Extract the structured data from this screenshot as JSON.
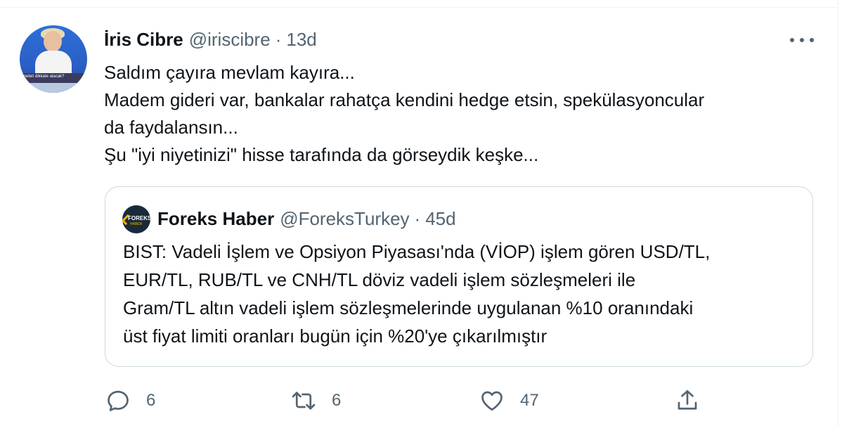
{
  "tweet": {
    "author_name": "İris Cibre",
    "handle": "@iriscibre",
    "separator": "·",
    "time": "13d",
    "text_lines": [
      "Saldım çayıra mevlam kayıra...",
      "Madem gideri var, bankalar rahatça kendini hedge etsin, spekülasyoncular",
      "da faydalansın...",
      "Şu \"iyi niyetinizi\" hisse tarafında da görseydik keşke..."
    ],
    "avatar_caption": "meleri dikkate alacak?"
  },
  "quoted": {
    "author_name": "Foreks Haber",
    "handle": "@ForeksTurkey",
    "separator": "·",
    "time": "45d",
    "logo_text": "FOREKS",
    "logo_sub": "HABER",
    "text_lines": [
      "BIST: Vadeli İşlem ve Opsiyon Piyasası'nda (VİOP) işlem gören USD/TL,",
      "EUR/TL, RUB/TL ve CNH/TL döviz vadeli işlem sözleşmeleri ile",
      "Gram/TL altın vadeli işlem sözleşmelerinde uygulanan %10 oranındaki",
      "üst fiyat limiti oranları bugün için %20'ye çıkarılmıştır"
    ]
  },
  "actions": {
    "reply_count": "6",
    "retweet_count": "6",
    "like_count": "47",
    "icons": [
      "reply-icon",
      "retweet-icon",
      "like-icon",
      "share-icon"
    ]
  },
  "colors": {
    "text_primary": "#0f1419",
    "text_secondary": "#536471",
    "border": "#cfd9de"
  }
}
